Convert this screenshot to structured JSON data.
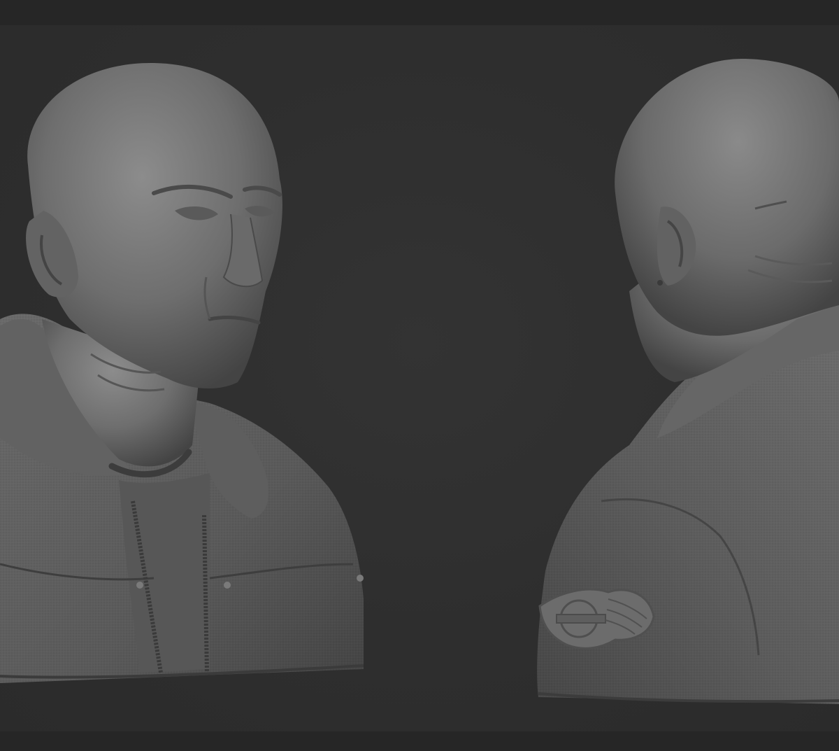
{
  "render": {
    "background_color": "#2b2b2b",
    "bar_color": "#262626",
    "clay_light": "#8a8a8a",
    "clay_mid": "#6d6d6d",
    "clay_dark": "#3e3e3e"
  },
  "icons": {
    "front_bust": "bust-front-view",
    "back_bust": "bust-back-view",
    "patch": "winged-emblem-icon"
  }
}
